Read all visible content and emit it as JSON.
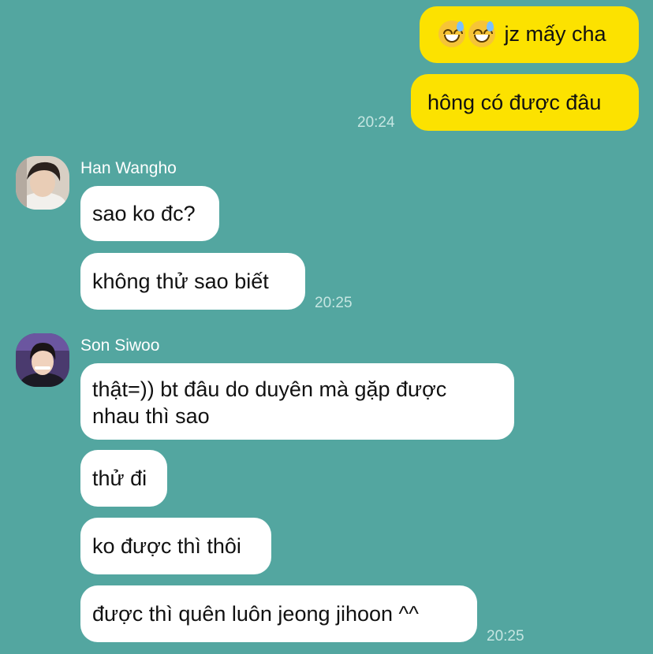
{
  "messages_self": [
    {
      "text": "jz mấy cha",
      "emoji": [
        "sweat-smile-emoji",
        "sweat-smile-emoji"
      ]
    },
    {
      "text": "hông có được đâu"
    }
  ],
  "time_self": "20:24",
  "han": {
    "name": "Han Wangho",
    "messages": [
      "sao ko đc?",
      "không thử sao biết"
    ],
    "time": "20:25"
  },
  "son": {
    "name": "Son Siwoo",
    "messages": [
      "thật=)) bt đâu do duyên mà gặp được",
      "nhau thì sao",
      "thử đi",
      "ko được thì thôi",
      "được thì quên luôn jeong jihoon ^^"
    ],
    "time": "20:25"
  },
  "colors": {
    "background": "#53a6a0",
    "mine_bubble": "#fce200",
    "their_bubble": "#ffffff"
  }
}
